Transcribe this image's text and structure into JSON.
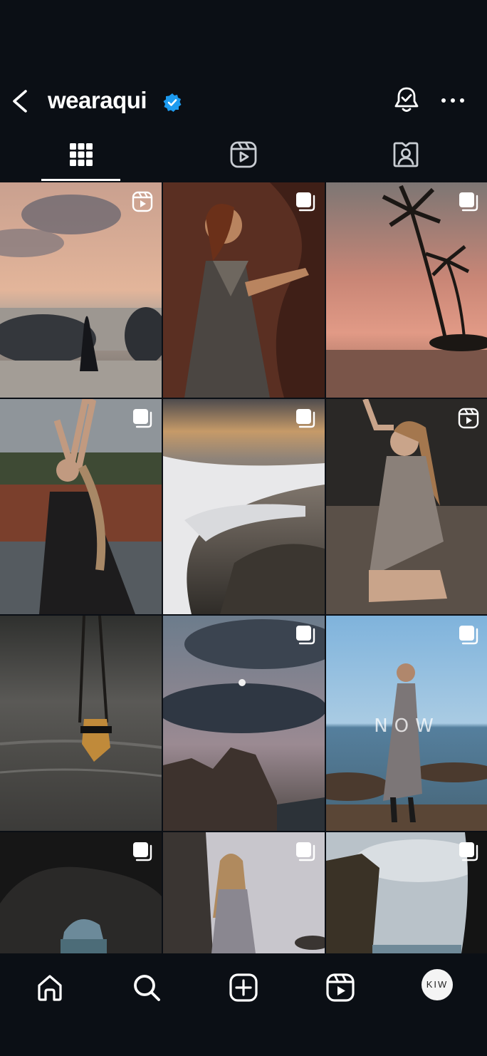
{
  "header": {
    "username": "wearaqui",
    "verified": true,
    "back_icon": "chevron-left-icon",
    "bell_icon": "notification-bell-check-icon",
    "more_icon": "more-horizontal-icon"
  },
  "tabs": [
    {
      "name": "posts",
      "icon": "grid-icon",
      "active": true
    },
    {
      "name": "reels",
      "icon": "reels-icon",
      "active": false
    },
    {
      "name": "tagged",
      "icon": "tagged-person-icon",
      "active": false
    }
  ],
  "posts": [
    {
      "scene": "sunset beach with rocks and woman in black dress",
      "badge": "reel"
    },
    {
      "scene": "woman in metallic wrap dress against red rock",
      "badge": "carousel"
    },
    {
      "scene": "palm trees silhouette at pink sunset beach",
      "badge": "carousel"
    },
    {
      "scene": "woman in black dress arms raised by water",
      "badge": "carousel"
    },
    {
      "scene": "sea foam over rocks at sunset",
      "badge": "carousel"
    },
    {
      "scene": "woman kneeling on dark sand in silver dress",
      "badge": "reel"
    },
    {
      "scene": "crystal pendant hanging over sea",
      "badge": "none"
    },
    {
      "scene": "clouds and moon over rocks at dusk",
      "badge": "carousel"
    },
    {
      "scene": "woman in grey dress on rocks by sea",
      "badge": "carousel",
      "overlay_text": "NOW"
    },
    {
      "scene": "dark sea cave arch",
      "badge": "carousel"
    },
    {
      "scene": "woman in grey dress against rocks",
      "badge": "carousel"
    },
    {
      "scene": "cliff and cloudy sky",
      "badge": "carousel"
    }
  ],
  "bottom_nav": {
    "items": [
      "home-icon",
      "search-icon",
      "create-post-icon",
      "reels-icon"
    ],
    "avatar_label": "KIW"
  },
  "colors": {
    "background": "#0b0f15",
    "verified_blue": "#1d9bf0",
    "icon_white": "#ffffff"
  }
}
